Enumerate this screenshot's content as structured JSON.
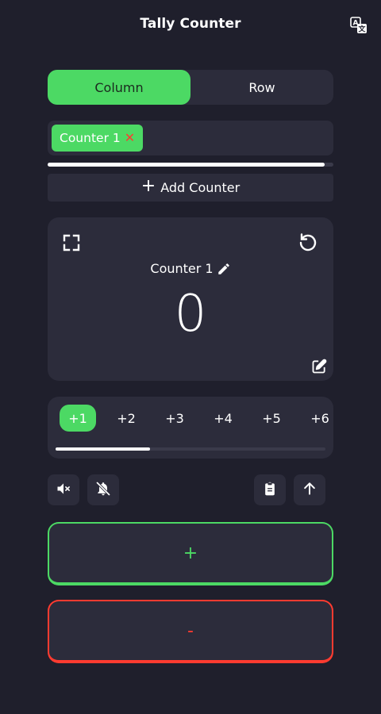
{
  "app": {
    "title": "Tally Counter"
  },
  "layout_toggle": {
    "options": [
      "Column",
      "Row"
    ],
    "selected": "Column"
  },
  "counter_tabs": [
    {
      "label": "Counter 1"
    }
  ],
  "add_counter": {
    "label": "Add Counter"
  },
  "counter": {
    "name": "Counter 1",
    "value": "0"
  },
  "steps": {
    "items": [
      "+1",
      "+2",
      "+3",
      "+4",
      "+5",
      "+6"
    ],
    "selected": "+1"
  },
  "scroll": {
    "counter_tabs_position": 0.97,
    "steps_position": 0.35
  },
  "controls": {
    "icons": [
      "mute-icon",
      "notifications-off-icon",
      "clipboard-icon",
      "arrow-up-icon"
    ]
  },
  "buttons": {
    "increment": "+",
    "decrement": "-"
  },
  "colors": {
    "background": "#1f1f2c",
    "surface": "#2c2c3b",
    "accent_green": "#4cd964",
    "accent_red": "#ff3b30",
    "text": "#ffffff"
  }
}
